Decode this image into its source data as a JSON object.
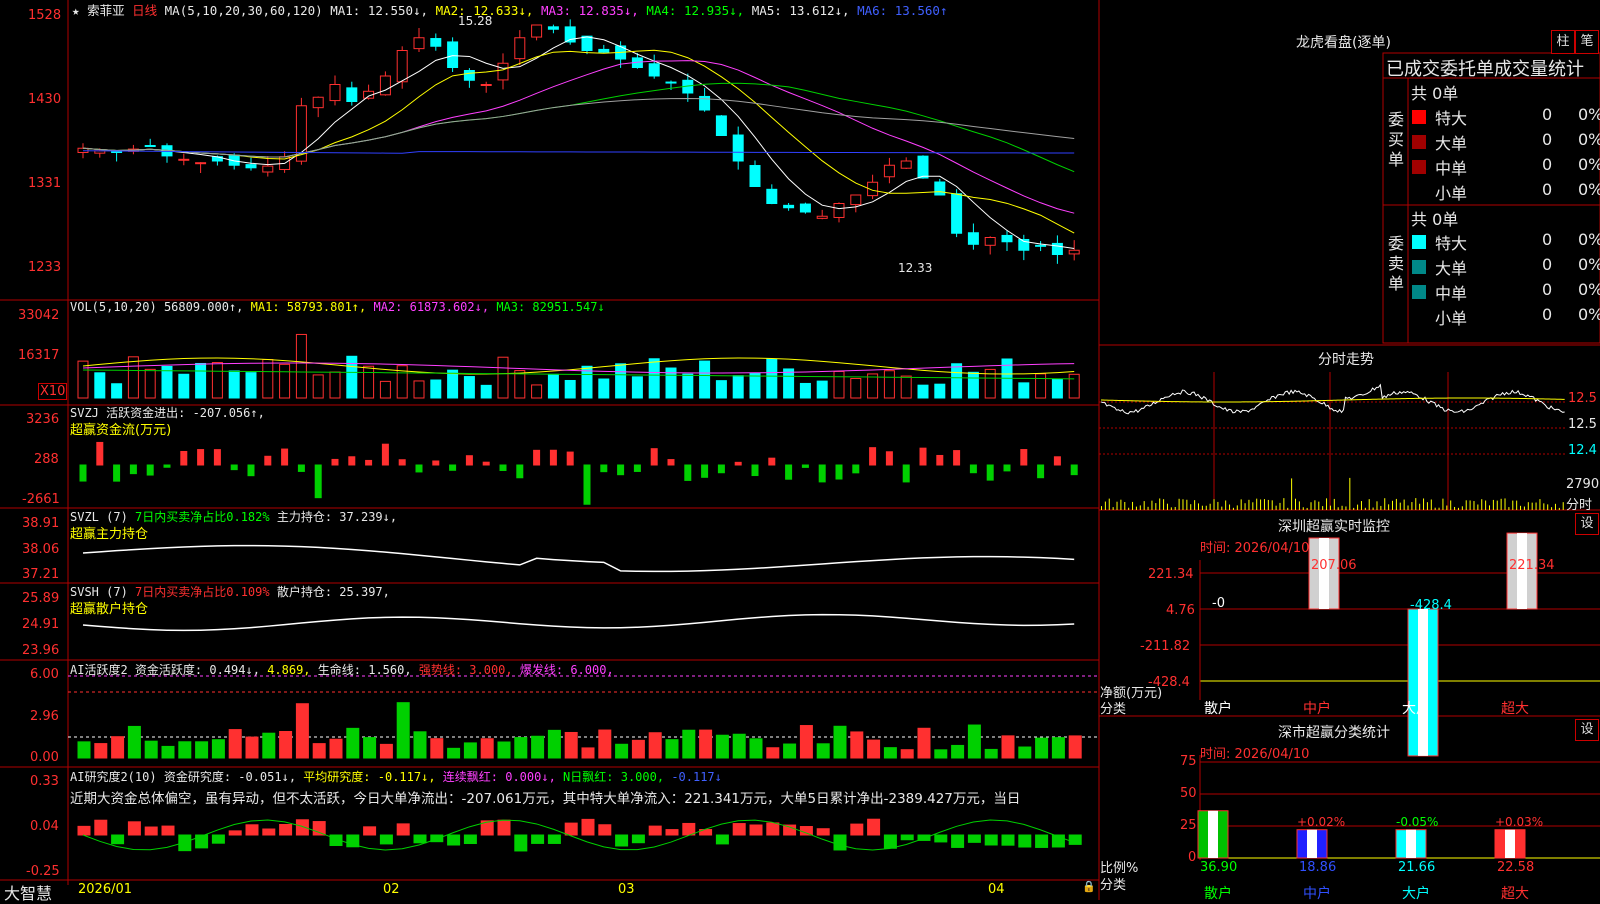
{
  "colors": {
    "up": "#ff3030",
    "down": "#00ffff",
    "grid": "#b00000",
    "ma1": "#ffffff",
    "ma2": "#ffff00",
    "ma3": "#ff40ff",
    "ma4": "#00d000",
    "ma5": "#a0a0a0",
    "ma6": "#3040ff"
  },
  "icons": {
    "star": "star-icon",
    "settings": "settings-icon",
    "lock": "lock-icon"
  },
  "header": {
    "star": "★",
    "stock": "索菲亚",
    "period": "日线",
    "ma_params": "MA(5,10,20,30,60,120)",
    "ma1": "MA1: 12.550↓,",
    "ma2": "MA2: 12.633↓,",
    "ma3": "MA3: 12.835↓,",
    "ma4": "MA4: 12.935↓,",
    "ma5": "MA5: 13.612↓,",
    "ma6": "MA6: 13.560↑"
  },
  "price_axis": [
    "1528",
    "1430",
    "1331",
    "1233"
  ],
  "price_marks": {
    "high": "15.28",
    "low": "12.33"
  },
  "vol": {
    "axis": [
      "33042",
      "16317"
    ],
    "unit": "X10",
    "title": "VOL(5,10,20)",
    "value": "56809.000↑,",
    "ma1": "MA1: 58793.801↑,",
    "ma2": "MA2: 61873.602↓,",
    "ma3": "MA3: 82951.547↓"
  },
  "svzj": {
    "axis": [
      "3236",
      "288",
      "-2661"
    ],
    "title": "SVZJ  活跃资金进出: -207.056↑,",
    "subtitle": "超赢资金流(万元)"
  },
  "svzl": {
    "axis": [
      "38.91",
      "38.06",
      "37.21"
    ],
    "title": "SVZL (7)",
    "pct": "7日内买卖净占比0.182%",
    "hold": "主力持仓: 37.239↓,",
    "subtitle": "超赢主力持仓"
  },
  "svsh": {
    "axis": [
      "25.89",
      "24.91",
      "23.96"
    ],
    "title": "SVSH (7)",
    "pct": "7日内买卖净占比0.109%",
    "hold": "散户持仓: 25.397,",
    "subtitle": "超赢散户持仓"
  },
  "ai1": {
    "axis": [
      "6.00",
      "2.96",
      "0.00"
    ],
    "title": "AI活跃度2",
    "a": "资金活跃度: 0.494↓,",
    "b": "4.869,",
    "c": "生命线: 1.560,",
    "d": "强势线: 3.000,",
    "e": "爆发线: 6.000,"
  },
  "ai2": {
    "axis": [
      "0.33",
      "0.04",
      "-0.25"
    ],
    "title": "AI研究度2(10)",
    "a": "资金研究度: -0.051↓,",
    "b": "平均研究度: -0.117↓,",
    "c": "连续飘红: 0.000↓,",
    "d": "N日飘红: 3.000,",
    "e": "-0.117↓",
    "desc": "近期大资金总体偏空，虽有异动，但不太活跃，今日大单净流出：-207.061万元，其中特大单净流入：221.341万元，大单5日累计净出-2389.427万元，当日"
  },
  "dates": {
    "app": "大智慧",
    "d1": "2026/01",
    "d2": "02",
    "d3": "03",
    "d4": "04"
  },
  "lhb": {
    "title": "龙虎看盘(逐单)",
    "btn1": "柱",
    "btn2": "笔",
    "header": "已成交委托单成交量统计",
    "buy_label": "委买单",
    "sell_label": "委卖单",
    "buy_total": "共 0单",
    "sell_total": "共 0单",
    "buy": [
      {
        "name": "特大",
        "v": "0",
        "p": "0%"
      },
      {
        "name": "大单",
        "v": "0",
        "p": "0%"
      },
      {
        "name": "中单",
        "v": "0",
        "p": "0%"
      },
      {
        "name": "小单",
        "v": "0",
        "p": "0%"
      }
    ],
    "sell": [
      {
        "name": "特大",
        "v": "0",
        "p": "0%"
      },
      {
        "name": "大单",
        "v": "0",
        "p": "0%"
      },
      {
        "name": "中单",
        "v": "0",
        "p": "0%"
      },
      {
        "name": "小单",
        "v": "0",
        "p": "0%"
      }
    ]
  },
  "intraday": {
    "title": "分时走势",
    "p1": "12.5",
    "p2": "12.5",
    "p3": "12.4",
    "v": "2790",
    "unit": "分时"
  },
  "sz_monitor": {
    "title": "深圳超赢实时监控",
    "btn": "设",
    "time": "时间: 2026/04/10",
    "axis": [
      "221.34",
      "4.76",
      "-211.82",
      "-428.4"
    ],
    "axis_title": "净额(万元)",
    "cat_title": "分类",
    "bars": [
      {
        "name": "散户",
        "v": "-0"
      },
      {
        "name": "中户",
        "v": "207.06"
      },
      {
        "name": "大户",
        "v": "-428.4"
      },
      {
        "name": "超大",
        "v": "221.34"
      }
    ],
    "values": [
      0,
      207.06,
      -428.4,
      221.34
    ]
  },
  "sz_class": {
    "title": "深市超赢分类统计",
    "btn": "设",
    "time": "时间: 2026/04/10",
    "axis": [
      "75",
      "50",
      "25",
      "0"
    ],
    "axis_title": "比例%",
    "cat_title": "分类",
    "bars": [
      {
        "name": "散户",
        "v": "36.90",
        "d": ""
      },
      {
        "name": "中户",
        "v": "18.86",
        "d": "+0.02%"
      },
      {
        "name": "大户",
        "v": "21.66",
        "d": "-0.05%"
      },
      {
        "name": "超大",
        "v": "22.58",
        "d": "+0.03%"
      }
    ],
    "values": [
      36.9,
      18.86,
      21.66,
      22.58
    ]
  }
}
